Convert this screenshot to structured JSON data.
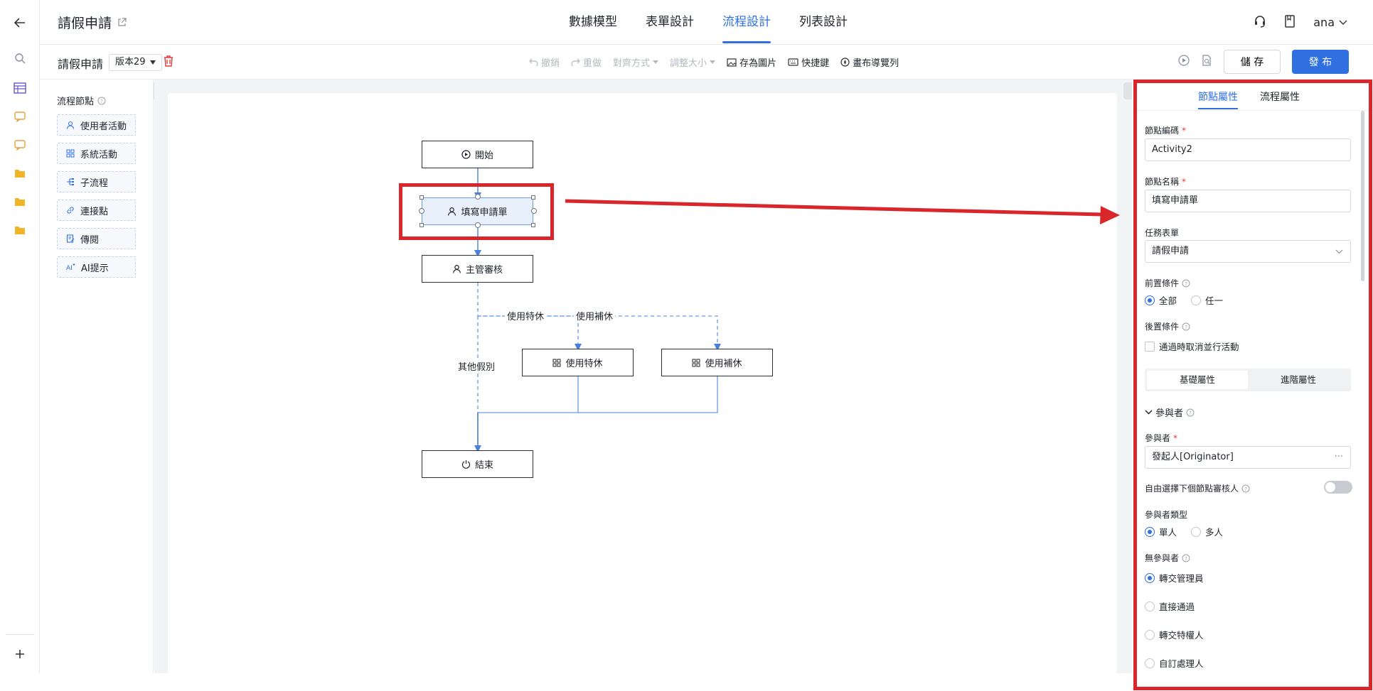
{
  "header": {
    "app_title": "請假申請",
    "tabs": [
      {
        "label": "數據模型",
        "active": false
      },
      {
        "label": "表單設計",
        "active": false
      },
      {
        "label": "流程設計",
        "active": true
      },
      {
        "label": "列表設計",
        "active": false
      }
    ],
    "user": "ana"
  },
  "toolbar": {
    "process_name": "請假申請",
    "version": "版本29",
    "undo": "撤銷",
    "redo": "重做",
    "align": "對齊方式",
    "resize": "調整大小",
    "save_image": "存為圖片",
    "shortcuts": "快捷鍵",
    "canvas_nav": "畫布導覽列",
    "save_label": "儲 存",
    "publish_label": "發 布"
  },
  "palette": {
    "title": "流程節點",
    "items": [
      "使用者活動",
      "系統活動",
      "子流程",
      "連接點",
      "傳閱",
      "AI提示"
    ]
  },
  "diagram": {
    "nodes": {
      "start": "開始",
      "fill_form": "填寫申請單",
      "manager_review": "主管審核",
      "special_leave": "使用特休",
      "comp_leave": "使用補休",
      "end": "結束"
    },
    "edge_labels": {
      "special": "使用特休",
      "comp": "使用補休",
      "other": "其他假別"
    }
  },
  "properties": {
    "tabs": [
      "節點屬性",
      "流程屬性"
    ],
    "node_code_label": "節點編碼",
    "node_code_value": "Activity2",
    "node_name_label": "節點名稱",
    "node_name_value": "填寫申請單",
    "task_form_label": "任務表單",
    "task_form_value": "請假申請",
    "pre_condition_label": "前置條件",
    "pre_options": [
      "全部",
      "任一"
    ],
    "post_condition_label": "後置條件",
    "post_checkbox": "通過時取消並行活動",
    "segments": [
      "基礎屬性",
      "進階屬性"
    ],
    "participants_section": "參與者",
    "participant_label": "參與者",
    "participant_value": "發起人[Originator]",
    "free_select_label": "自由選擇下個節點審核人",
    "participant_type_label": "參與者類型",
    "type_options": [
      "單人",
      "多人"
    ],
    "no_participant_label": "無參與者",
    "no_participant_options": [
      "轉交管理員",
      "直接通過",
      "轉交特權人",
      "自訂處理人"
    ]
  },
  "colors": {
    "accent": "#2f6fe0",
    "annotation": "#d9262b"
  }
}
